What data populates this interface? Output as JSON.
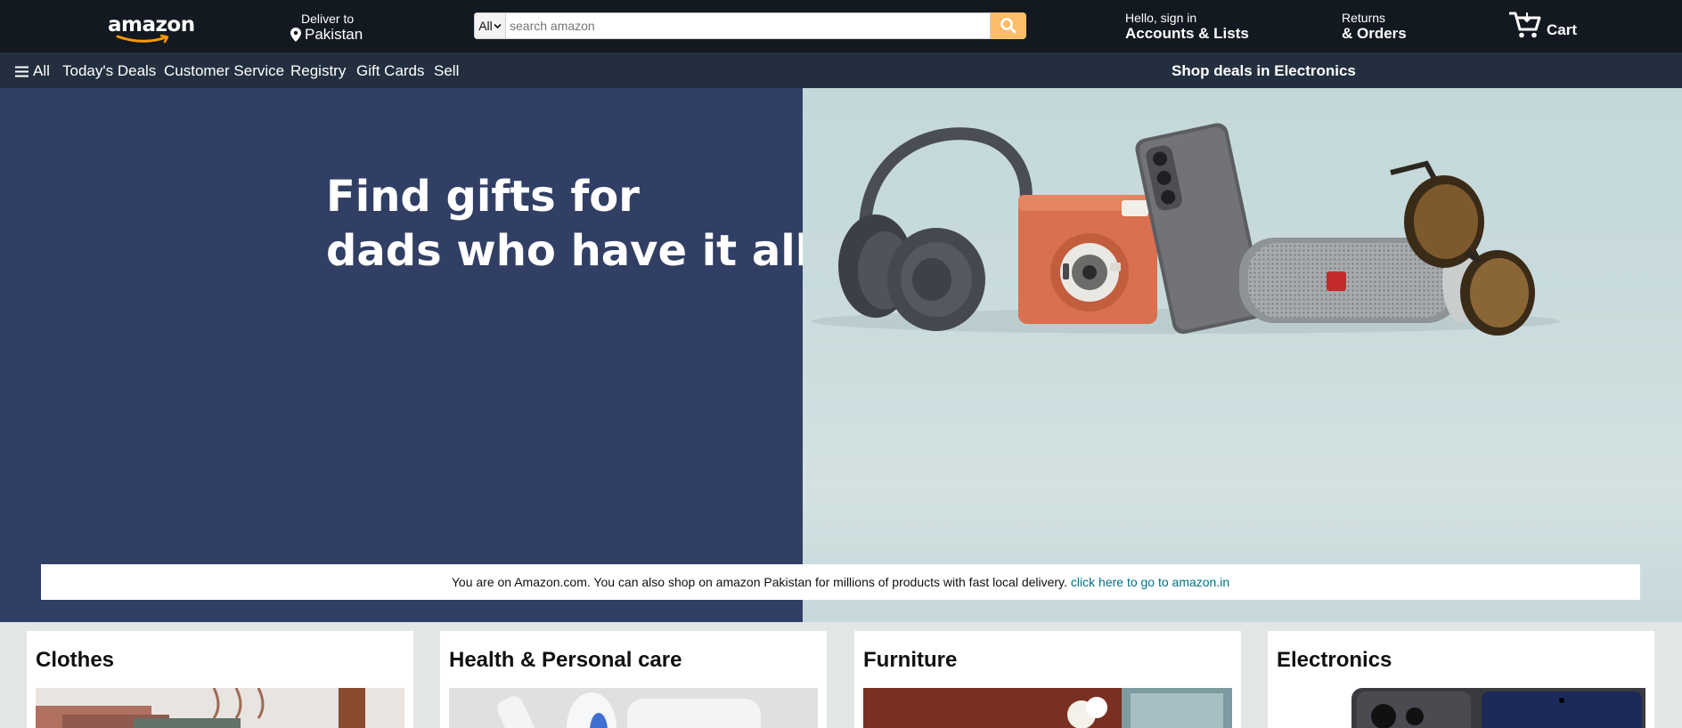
{
  "header": {
    "logo_text": "amazon",
    "deliver": {
      "line1": "Deliver to",
      "location": "Pakistan"
    },
    "search": {
      "category": "All",
      "placeholder": "search amazon"
    },
    "account": {
      "greeting": "Hello, sign in",
      "label": "Accounts & Lists"
    },
    "returns": {
      "line1": "Returns",
      "line2": "& Orders"
    },
    "cart": {
      "label": "Cart"
    }
  },
  "subnav": {
    "all_label": "All",
    "items": [
      "Today's Deals",
      "Customer Service",
      "Registry",
      "Gift Cards",
      "Sell"
    ],
    "promo": "Shop deals in Electronics"
  },
  "hero": {
    "headline_line1": "Find gifts for",
    "headline_line2": "dads who have it all"
  },
  "notice": {
    "text": "You are on Amazon.com. You can also shop on amazon Pakistan for millions of products with fast local delivery.",
    "link": "click here to go to amazon.in"
  },
  "cards": [
    {
      "title": "Clothes"
    },
    {
      "title": "Health & Personal care"
    },
    {
      "title": "Furniture"
    },
    {
      "title": "Electronics"
    }
  ],
  "colors": {
    "nav_bg": "#131921",
    "subnav_bg": "#232f3e",
    "search_button": "#febd69",
    "hero_left_bg": "#323f64",
    "link": "#007185",
    "logo_smile": "#ff9900"
  },
  "icons": [
    "map-pin-icon",
    "chevron-down-icon",
    "search-icon",
    "hamburger-menu-icon",
    "cart-icon",
    "amazon-smile-icon"
  ]
}
